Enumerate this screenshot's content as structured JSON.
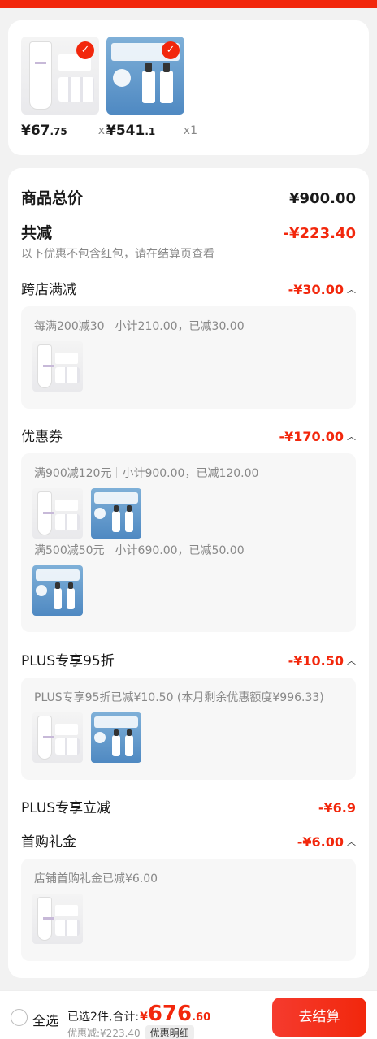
{
  "colors": {
    "accent": "#f2270c",
    "panel": "#f7f7f7"
  },
  "products": [
    {
      "name": "loreal-cleanser",
      "price_int": "¥67",
      "price_dec": ".75",
      "qty": "x2"
    },
    {
      "name": "sisley-serum",
      "price_int": "¥541",
      "price_dec": ".1",
      "qty": "x1"
    }
  ],
  "summary": {
    "total_label": "商品总价",
    "total_value": "¥900.00",
    "reduce_label": "共减",
    "reduce_value": "-¥223.40",
    "note": "以下优惠不包含红包，请在结算页查看"
  },
  "sections": {
    "cross_store": {
      "label": "跨店满减",
      "value": "-¥30.00",
      "line1_a": "每满200减30",
      "line1_b": "小计210.00，已减30.00"
    },
    "coupon": {
      "label": "优惠券",
      "value": "-¥170.00",
      "line1_a": "满900减120元",
      "line1_b": "小计900.00，已减120.00",
      "line2_a": "满500减50元",
      "line2_b": "小计690.00，已减50.00"
    },
    "plus95": {
      "label": "PLUS专享95折",
      "value": "-¥10.50",
      "line1": "PLUS专享95折已减¥10.50 (本月剩余优惠额度¥996.33)"
    },
    "plus_direct": {
      "label": "PLUS专享立减",
      "value": "-¥6.9"
    },
    "first_buy": {
      "label": "首购礼金",
      "value": "-¥6.00",
      "line1": "店铺首购礼金已减¥6.00"
    }
  },
  "bottom_bar": {
    "select_all": "全选",
    "selected_text": "已选2件,合计:",
    "total_symbol": "¥",
    "total_int": "676",
    "total_dec": ".60",
    "discount_text": "优惠减:¥223.40",
    "detail_button": "优惠明细",
    "checkout_button": "去结算"
  }
}
